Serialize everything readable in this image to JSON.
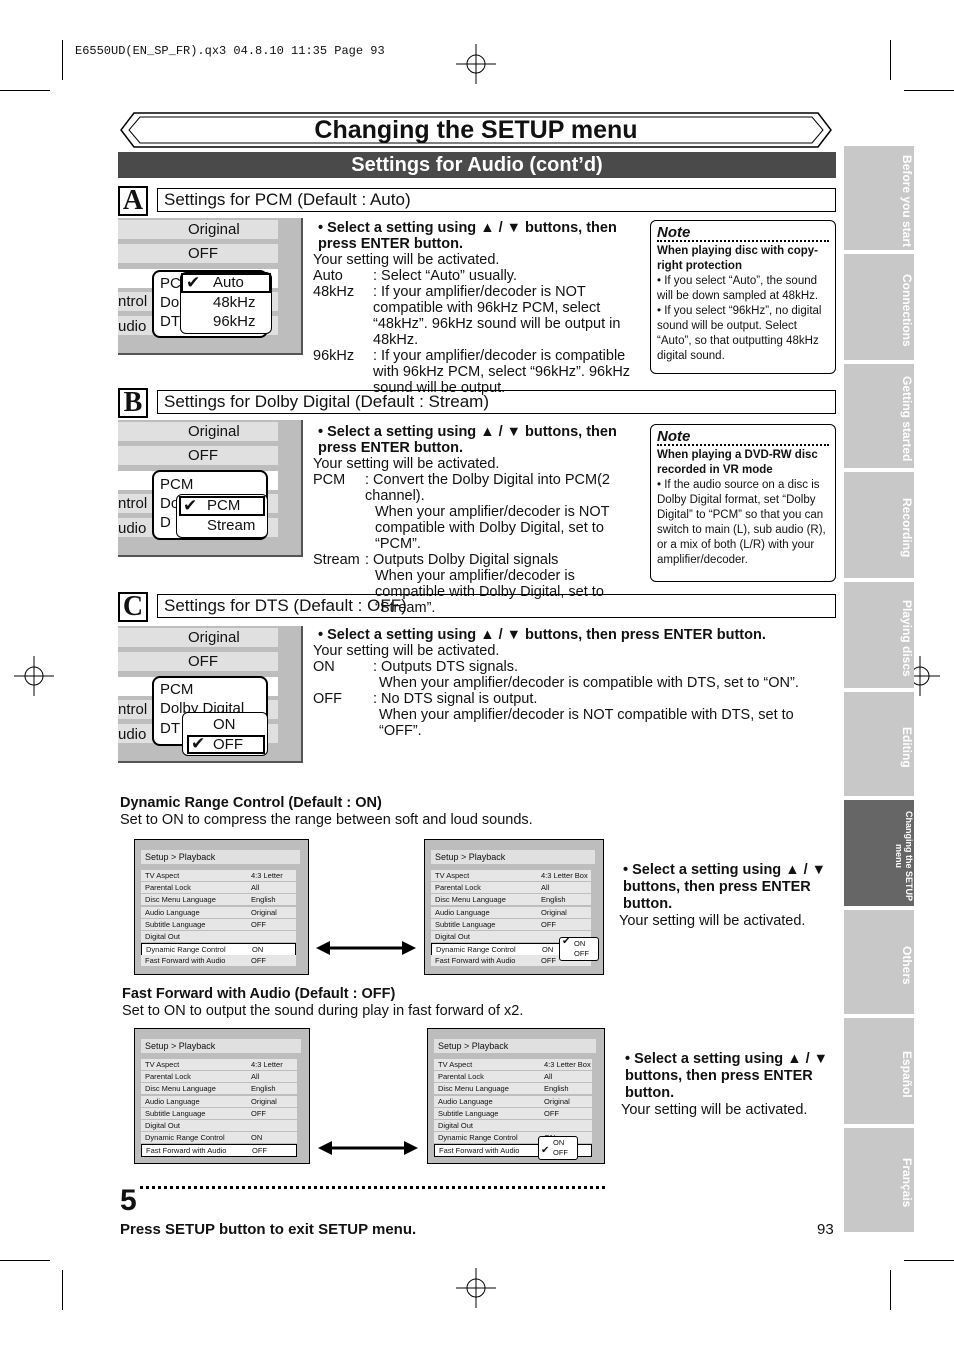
{
  "header": {
    "file_info": "E6550UD(EN_SP_FR).qx3   04.8.10   11:35   Page 93"
  },
  "title": "Changing the SETUP menu",
  "subtitle": "Settings for Audio (cont’d)",
  "section_a": {
    "letter": "A",
    "heading": "Settings for PCM (Default : Auto)",
    "menu": {
      "row1": "Original",
      "row2": "OFF",
      "side1": "ntrol",
      "side2": "udio",
      "under1": "PC",
      "under2": "Dol",
      "under3": "DT",
      "opt1": "Auto",
      "opt2": "48kHz",
      "opt3": "96kHz",
      "check": "✔"
    },
    "instruction": "• Select a setting using ▲ / ▼ buttons, then press ENTER button.",
    "activated": "Your setting will be activated.",
    "l1k": "Auto",
    "l1v": ": Select “Auto” usually.",
    "l2k": "48kHz",
    "l2v": ": If your amplifier/decoder is NOT compatible with 96kHz PCM, select “48kHz”. 96kHz sound will be output in 48kHz.",
    "l3k": "96kHz",
    "l3v": ": If your amplifier/decoder is compatible with 96kHz PCM, select “96kHz”. 96kHz sound will be output.",
    "note": {
      "title": "Note",
      "head": "When playing disc with copy-right protection",
      "b1": "• If you select “Auto”, the sound will be down sampled at 48kHz.",
      "b2": "• If you select “96kHz”, no digital sound will be output. Select “Auto”, so that outputting 48kHz digital sound."
    }
  },
  "section_b": {
    "letter": "B",
    "heading": "Settings for Dolby Digital (Default : Stream)",
    "menu": {
      "row1": "Original",
      "row2": "OFF",
      "side1": "ntrol",
      "side2": "udio",
      "under1": "PCM",
      "under2": "Do",
      "under3": "D",
      "opt1": "PCM",
      "opt2": "Stream",
      "check": "✔"
    },
    "instruction": "• Select a setting using ▲ / ▼ buttons, then press ENTER button.",
    "activated": "Your setting will be activated.",
    "l1k": "PCM",
    "l1v": ": Convert the Dolby Digital into PCM(2 channel).",
    "l1v2": "When your amplifier/decoder is NOT compatible with Dolby Digital, set to “PCM”.",
    "l2k": "Stream",
    "l2v": ": Outputs Dolby Digital signals",
    "l2v2": "When your amplifier/decoder is compatible with Dolby Digital, set to “Stream”.",
    "note": {
      "title": "Note",
      "head": "When playing a DVD-RW disc recorded in VR mode",
      "b1": "• If the audio source on a disc is Dolby Digital format, set “Dolby Digital” to “PCM” so that you can switch to main (L), sub audio (R), or a mix of both (L/R) with your amplifier/decoder."
    }
  },
  "section_c": {
    "letter": "C",
    "heading": "Settings for DTS (Default : OFF)",
    "menu": {
      "row1": "Original",
      "row2": "OFF",
      "side1": "ntrol",
      "side2": "udio",
      "under1": "PCM",
      "under2": "Dolby Digital",
      "under3": "DT",
      "opt1": "ON",
      "opt2": "OFF",
      "check": "✔"
    },
    "instruction": "• Select a setting using ▲ / ▼ buttons, then press ENTER button.",
    "activated": "Your setting will be activated.",
    "l1k": "ON",
    "l1v": ": Outputs DTS signals.",
    "l1v2": "When your amplifier/decoder is compatible with DTS, set to “ON”.",
    "l2k": "OFF",
    "l2v": ": No DTS signal is output.",
    "l2v2": "When your amplifier/decoder is NOT compatible with DTS, set to “OFF”."
  },
  "drc": {
    "heading": "Dynamic Range Control (Default : ON)",
    "desc": "Set to ON to compress the range between soft and loud sounds.",
    "instruction": "• Select a setting using ▲ / ▼ buttons, then press ENTER button.",
    "activated": "Your setting will be activated."
  },
  "ffa": {
    "heading": "Fast Forward with Audio (Default : OFF)",
    "desc": "Set to ON to output the sound during play in fast forward of x2.",
    "instruction": "• Select a setting using ▲ / ▼ buttons, then press ENTER button.",
    "activated": "Your setting will be activated."
  },
  "screen": {
    "bar": "Setup > Playback",
    "rows": [
      {
        "k": "TV Aspect",
        "v": "4:3 Letter Box"
      },
      {
        "k": "Parental Lock",
        "v": "All"
      },
      {
        "k": "Disc Menu Language",
        "v": "English"
      },
      {
        "k": "Audio Language",
        "v": "Original"
      },
      {
        "k": "Subtitle Language",
        "v": "OFF"
      },
      {
        "k": "Digital Out",
        "v": ""
      },
      {
        "k": "Dynamic Range Control",
        "v": "ON"
      },
      {
        "k": "Fast Forward with Audio",
        "v": "OFF"
      }
    ],
    "popup_on": "ON",
    "popup_off": "OFF",
    "check": "✔"
  },
  "step5": {
    "number": "5",
    "text": "Press SETUP button to exit SETUP menu."
  },
  "page_number": "93",
  "tabs": [
    "Before you start",
    "Connections",
    "Getting started",
    "Recording",
    "Playing discs",
    "Editing",
    "Changing the SETUP menu",
    "Others",
    "Español",
    "Français"
  ]
}
